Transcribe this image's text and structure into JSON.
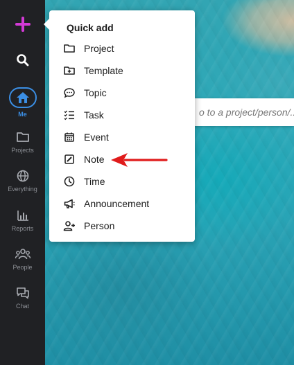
{
  "sidebar": {
    "add_icon": "plus-icon",
    "search_icon": "search-icon",
    "items": [
      {
        "id": "me",
        "label": "Me",
        "icon": "home-icon",
        "active": true
      },
      {
        "id": "projects",
        "label": "Projects",
        "icon": "folder-icon"
      },
      {
        "id": "everything",
        "label": "Everything",
        "icon": "globe-icon"
      },
      {
        "id": "reports",
        "label": "Reports",
        "icon": "bar-chart-icon"
      },
      {
        "id": "people",
        "label": "People",
        "icon": "people-icon"
      },
      {
        "id": "chat",
        "label": "Chat",
        "icon": "chat-icon"
      }
    ]
  },
  "quick_add": {
    "title": "Quick add",
    "items": [
      {
        "label": "Project",
        "icon": "folder-icon"
      },
      {
        "label": "Template",
        "icon": "folder-plus-icon"
      },
      {
        "label": "Topic",
        "icon": "comment-icon"
      },
      {
        "label": "Task",
        "icon": "checklist-icon"
      },
      {
        "label": "Event",
        "icon": "calendar-icon"
      },
      {
        "label": "Note",
        "icon": "edit-note-icon"
      },
      {
        "label": "Time",
        "icon": "clock-icon"
      },
      {
        "label": "Announcement",
        "icon": "megaphone-icon"
      },
      {
        "label": "Person",
        "icon": "person-add-icon"
      }
    ]
  },
  "search": {
    "placeholder": "o to a project/person/..."
  },
  "colors": {
    "sidebar_bg": "#202124",
    "accent_blue": "#3b8fe5",
    "plus_magenta": "#d33ad6",
    "arrow_red": "#e01b1b"
  }
}
